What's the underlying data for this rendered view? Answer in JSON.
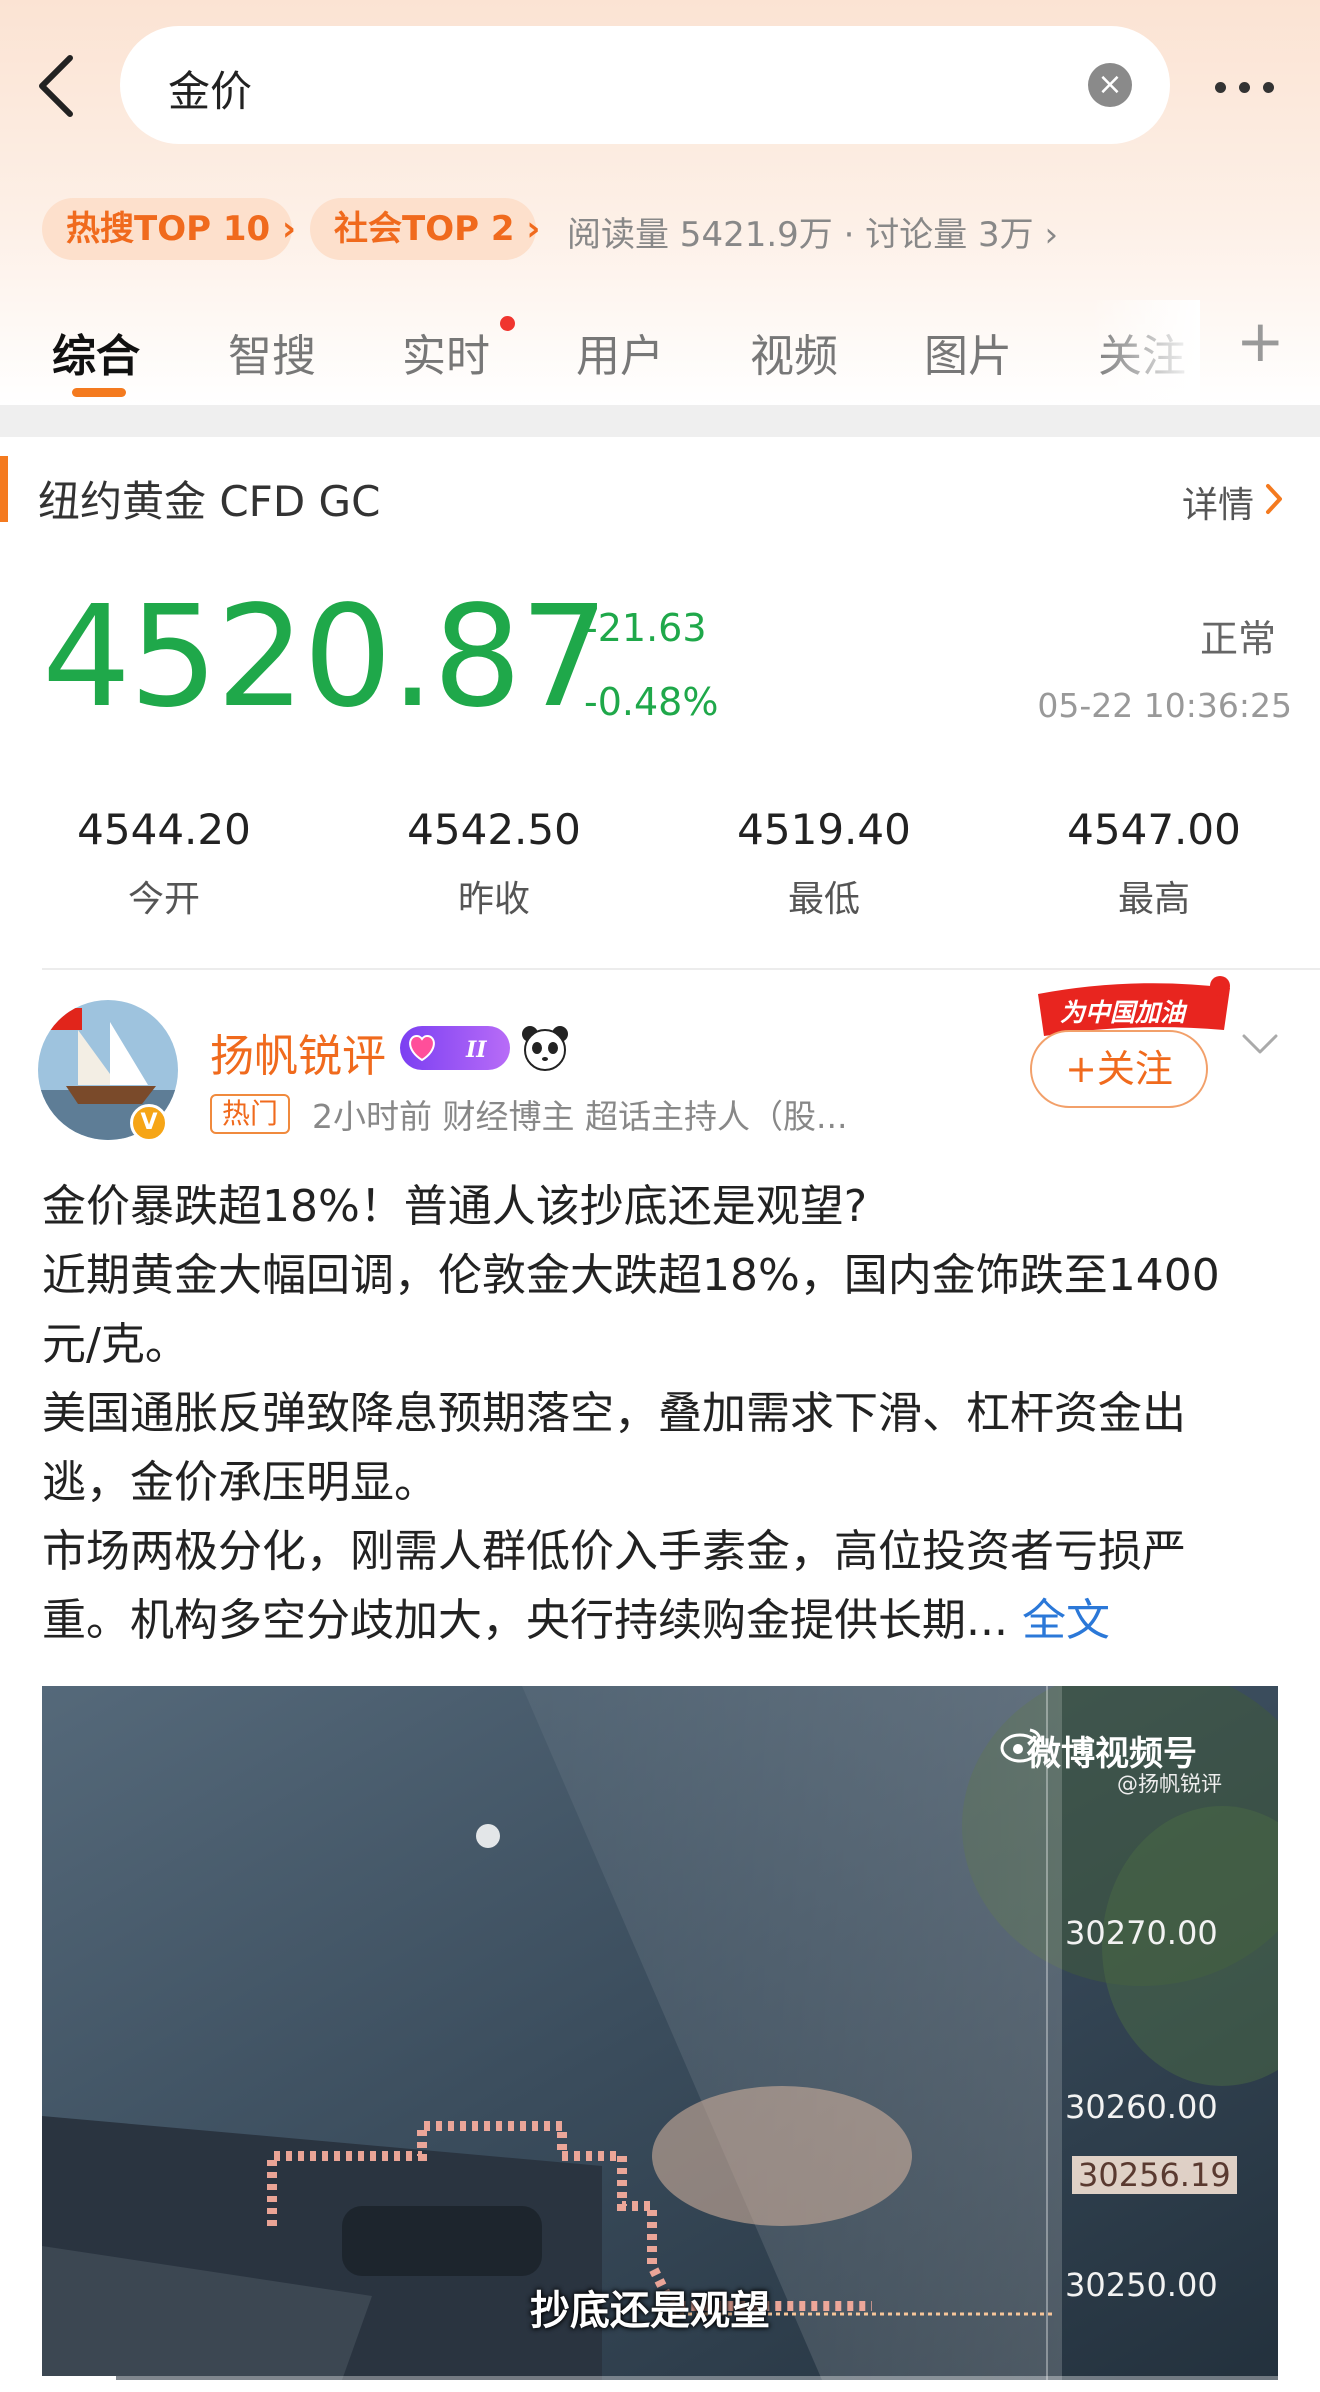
{
  "search": {
    "query": "金价"
  },
  "topic": {
    "badge_hot": "热搜TOP 10",
    "badge_social": "社会TOP 2",
    "stats": "阅读量 5421.9万 · 讨论量 3万"
  },
  "tabs": [
    {
      "label": "综合",
      "active": true
    },
    {
      "label": "智搜"
    },
    {
      "label": "实时",
      "has_dot": true
    },
    {
      "label": "用户"
    },
    {
      "label": "视频"
    },
    {
      "label": "图片"
    },
    {
      "label": "关注"
    }
  ],
  "market": {
    "title": "纽约黄金 CFD GC",
    "detail_label": "详情",
    "price": "4520.87",
    "change_abs": "-21.63",
    "change_pct": "-0.48%",
    "status": "正常",
    "time": "05-22 10:36:25",
    "metrics": [
      {
        "value": "4544.20",
        "label": "今开"
      },
      {
        "value": "4542.50",
        "label": "昨收"
      },
      {
        "value": "4519.40",
        "label": "最低"
      },
      {
        "value": "4547.00",
        "label": "最高"
      }
    ],
    "price_color": "#1fa84a"
  },
  "post": {
    "author": "扬帆锐评",
    "level": "II",
    "hot_tag": "热门",
    "meta": "2小时前  财经博主 超话主持人（股...",
    "campaign": "为中国加油",
    "follow_label": "+关注",
    "body": [
      "金价暴跌超18%！普通人该抄底还是观望?",
      "近期黄金大幅回调，伦敦金大跌超18%，国内金饰跌至1400元/克。",
      "美国通胀反弹致降息预期落空，叠加需求下滑、杠杆资金出逃，金价承压明显。",
      "市场两极分化，刚需人群低价入手素金，高位投资者亏损严重。机构多空分歧加大，央行持续购金提供长期..."
    ],
    "read_more": "全文",
    "accent_color": "#f06a1d"
  },
  "video": {
    "watermark": "微博视频号",
    "watermark_user": "@扬帆锐评",
    "ticks": [
      "30270.00",
      "30260.00",
      "30256.19",
      "30250.00"
    ],
    "subtitle": "抄底还是观望",
    "progress": 0.06
  }
}
